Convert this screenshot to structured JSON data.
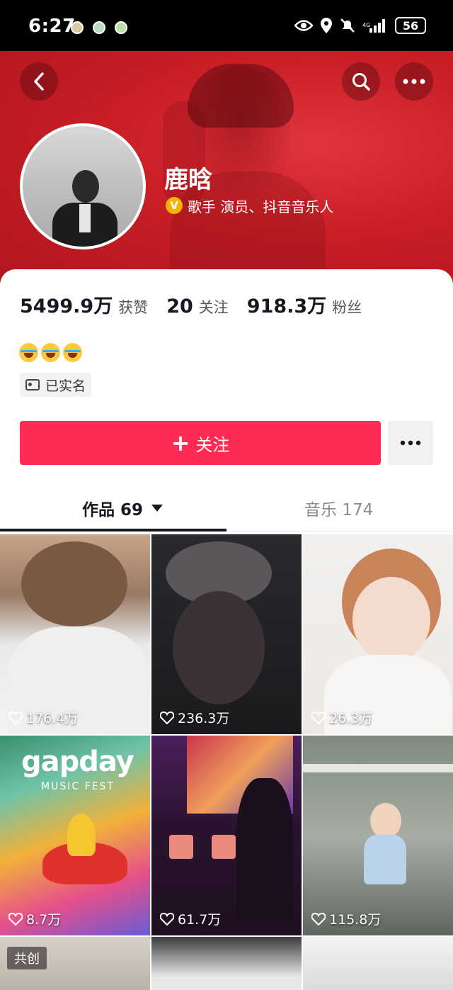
{
  "status_bar": {
    "time": "6:27",
    "battery": "56"
  },
  "profile": {
    "name": "鹿晗",
    "verified_badge": "V",
    "title": "歌手 演员、抖音音乐人",
    "stats": [
      {
        "value": "5499.9万",
        "label": "获赞"
      },
      {
        "value": "20",
        "label": "关注"
      },
      {
        "value": "918.3万",
        "label": "粉丝"
      }
    ],
    "realname_label": "已实名"
  },
  "actions": {
    "follow_label": "关注",
    "follow_color": "#fe2c55"
  },
  "tabs": {
    "works_label": "作品 69",
    "music_label": "音乐 174"
  },
  "videos": [
    {
      "likes": "176.4万"
    },
    {
      "likes": "236.3万"
    },
    {
      "likes": "26.3万"
    },
    {
      "likes": "8.7万"
    },
    {
      "likes": "61.7万"
    },
    {
      "likes": "115.8万"
    },
    {
      "badge": "共创"
    },
    {},
    {}
  ],
  "poster": {
    "brand": "gapday",
    "subtitle": "MUSIC FEST"
  }
}
